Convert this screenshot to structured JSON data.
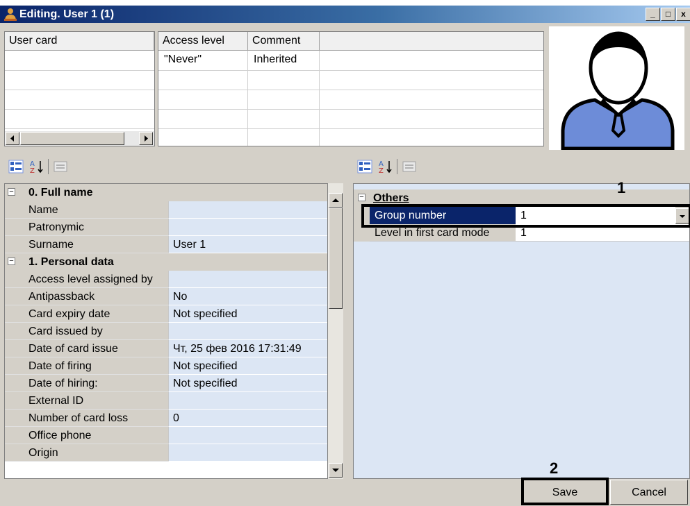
{
  "window": {
    "title": "Editing. User 1 (1)",
    "minimize_glyph": "_",
    "maximize_glyph": "□",
    "close_glyph": "x"
  },
  "card_table": {
    "header": "User card"
  },
  "access_table": {
    "headers": [
      "Access level",
      "Comment"
    ],
    "rows": [
      {
        "level": "\"Never\"",
        "comment": "Inherited"
      }
    ]
  },
  "left_grid": {
    "categories": [
      {
        "label": "0. Full name",
        "rows": [
          {
            "name": "Name",
            "value": ""
          },
          {
            "name": "Patronymic",
            "value": ""
          },
          {
            "name": "Surname",
            "value": "User 1"
          }
        ]
      },
      {
        "label": "1. Personal data",
        "rows": [
          {
            "name": "Access level assigned by",
            "value": ""
          },
          {
            "name": "Antipassback",
            "value": "No"
          },
          {
            "name": "Card expiry date",
            "value": "Not specified"
          },
          {
            "name": "Card issued by",
            "value": ""
          },
          {
            "name": "Date of card issue",
            "value": "Чт, 25 фев 2016 17:31:49"
          },
          {
            "name": "Date of firing",
            "value": "Not specified"
          },
          {
            "name": "Date of hiring:",
            "value": "Not specified"
          },
          {
            "name": "External ID",
            "value": ""
          },
          {
            "name": "Number of card loss",
            "value": "0"
          },
          {
            "name": "Office phone",
            "value": ""
          },
          {
            "name": "Origin",
            "value": ""
          }
        ]
      }
    ]
  },
  "right_grid": {
    "category": "Others",
    "rows": [
      {
        "name": "Group number",
        "value": "1"
      },
      {
        "name": "Level in first card mode",
        "value": "1"
      }
    ]
  },
  "callouts": {
    "one": "1",
    "two": "2"
  },
  "buttons": {
    "save": "Save",
    "cancel": "Cancel"
  },
  "colors": {
    "title_bar": "#0a246a",
    "selection": "#0a246a",
    "value_bg": "#dce6f4",
    "avatar": "#6d8cd8"
  }
}
